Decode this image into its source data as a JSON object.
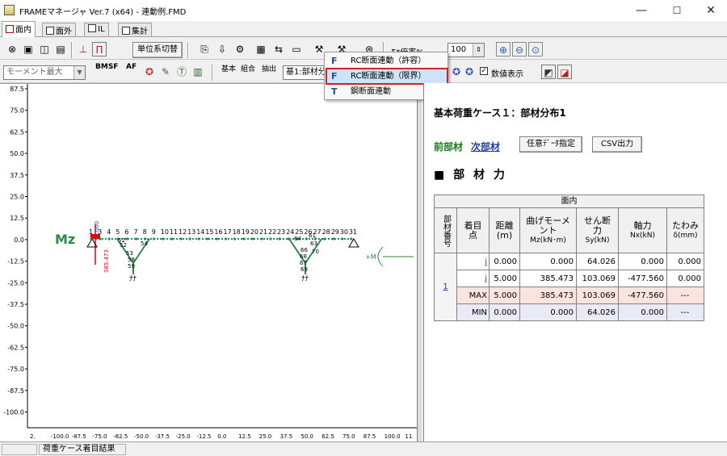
{
  "window": {
    "title": "FRAMEマネージャ Ver.7 (x64) - 連動例.FMD",
    "minimize": "—",
    "maximize": "☐",
    "close": "✕"
  },
  "tabs": [
    "面内",
    "面外",
    "IL",
    "集計"
  ],
  "toolbar1": {
    "unit_switch": "単位系切替",
    "zoom_label": "Σ*倍率%",
    "zoom_value": "100"
  },
  "toolbar2": {
    "moment_combo": "モーメント最大",
    "bmsf": "BMSF",
    "af": "AF",
    "kihon": "基本",
    "kumiawase": "組合",
    "chushutsu": "抽出",
    "case_combo": "基1:部材分",
    "numeric_display": "数値表示"
  },
  "menu": {
    "items": [
      "RC断面連動（許容）",
      "RC断面連動（限界）",
      "鋼断面連動"
    ],
    "selected_index": 1
  },
  "canvas": {
    "mz_label": "Mz",
    "y_ticks": [
      "87.5",
      "75.0",
      "62.5",
      "50.0",
      "37.5",
      "25.0",
      "12.5",
      "0.0",
      "-12.5",
      "-25.0",
      "-37.5",
      "-50.0",
      "-62.5",
      "-75.0",
      "-87.5",
      "-100.0"
    ],
    "x_ticks": [
      "2.",
      "-100.0",
      "-87.5",
      "-75.0",
      "-62.5",
      "-50.0",
      "-37.5",
      "-25.0",
      "-12.5",
      "0.0",
      "12.5",
      "25.0",
      "37.5",
      "50.0",
      "62.5",
      "75.0",
      "87.5",
      "100.0",
      "11"
    ],
    "node_labels": [
      "1",
      "3",
      "4",
      "5",
      "6",
      "7",
      "8",
      "9",
      "10",
      "11",
      "12",
      "13",
      "14",
      "15",
      "16",
      "17",
      "18",
      "19",
      "20",
      "21",
      "22",
      "23",
      "24",
      "25",
      "26",
      "27",
      "28",
      "29",
      "30",
      "31"
    ],
    "member_labels": [
      "54",
      "52",
      "53",
      "58",
      "59",
      "61",
      "63",
      "66",
      "68",
      "67",
      "69",
      "70",
      "52",
      "64"
    ],
    "value_labels": {
      "zero": "0.000",
      "max": "385.473"
    },
    "axis_symbol": "+M"
  },
  "result": {
    "title": "基本荷重ケース１：部材分布1",
    "prev_member": "前部材",
    "next_member": "次部材",
    "custom_data_btn": "任意ﾃﾞｰﾀ指定",
    "csv_btn": "CSV出力",
    "section_title": "■ 部 材 力",
    "group_header": "面内",
    "columns": [
      "部材番号",
      "着目点",
      "距離(m)",
      "曲げモーメントMz(kN･m)",
      "せん断力Sy(kN)",
      "軸力Nx(kN)",
      "たわみδ(mm)"
    ],
    "col_main": [
      "部材番号",
      "着目",
      "距離",
      "曲げモーメ\nント",
      "せん断\n力",
      "軸力",
      "たわみ"
    ],
    "col_sub": [
      "",
      "点",
      "(m)",
      "Mz(kN･m)",
      "Sy(kN)",
      "Nx(kN)",
      "δ(mm)"
    ],
    "member_no": "1",
    "rows": [
      {
        "point": "i",
        "dist": "0.000",
        "mz": "0.000",
        "sy": "64.026",
        "nx": "0.000",
        "defl": "0.000"
      },
      {
        "point": "j",
        "dist": "5.000",
        "mz": "385.473",
        "sy": "103.069",
        "nx": "-477.560",
        "defl": "0.000"
      },
      {
        "point": "MAX",
        "dist": "5.000",
        "mz": "385.473",
        "sy": "103.069",
        "nx": "-477.560",
        "defl": "---"
      },
      {
        "point": "MIN",
        "dist": "0.000",
        "mz": "0.000",
        "sy": "64.026",
        "nx": "0.000",
        "defl": "---"
      }
    ]
  },
  "status": {
    "panel1": "",
    "panel2": "荷重ケース着目結果"
  },
  "colors": {
    "link_green": "#1a7a1a",
    "link_blue": "#1f3fa0",
    "max_row": "#fbe4e0",
    "min_row": "#eaeaf6",
    "highlight_red": "#d0202a",
    "beam_green": "#2a8a4a"
  }
}
